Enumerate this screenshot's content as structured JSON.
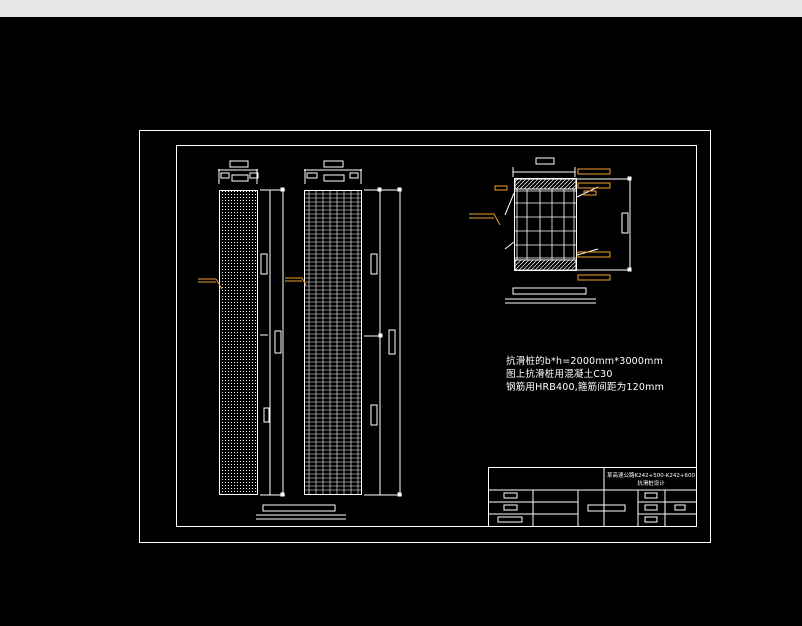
{
  "window": {
    "title_bar": ""
  },
  "colors": {
    "background": "#000000",
    "lines": "#ffffff",
    "annotation": "#f0a030",
    "topbar": "#e6e6e6"
  },
  "notes": {
    "line1": "抗滑桩的b*h=2000mm*3000mm",
    "line2": "图上抗滑桩用混凝土C30",
    "line3": "钢筋用HRB400,箍筋间距为120mm"
  },
  "title_block": {
    "title_line1": "某高速公路K242+500-K242+600",
    "title_line2": "抗滑桩设计"
  }
}
